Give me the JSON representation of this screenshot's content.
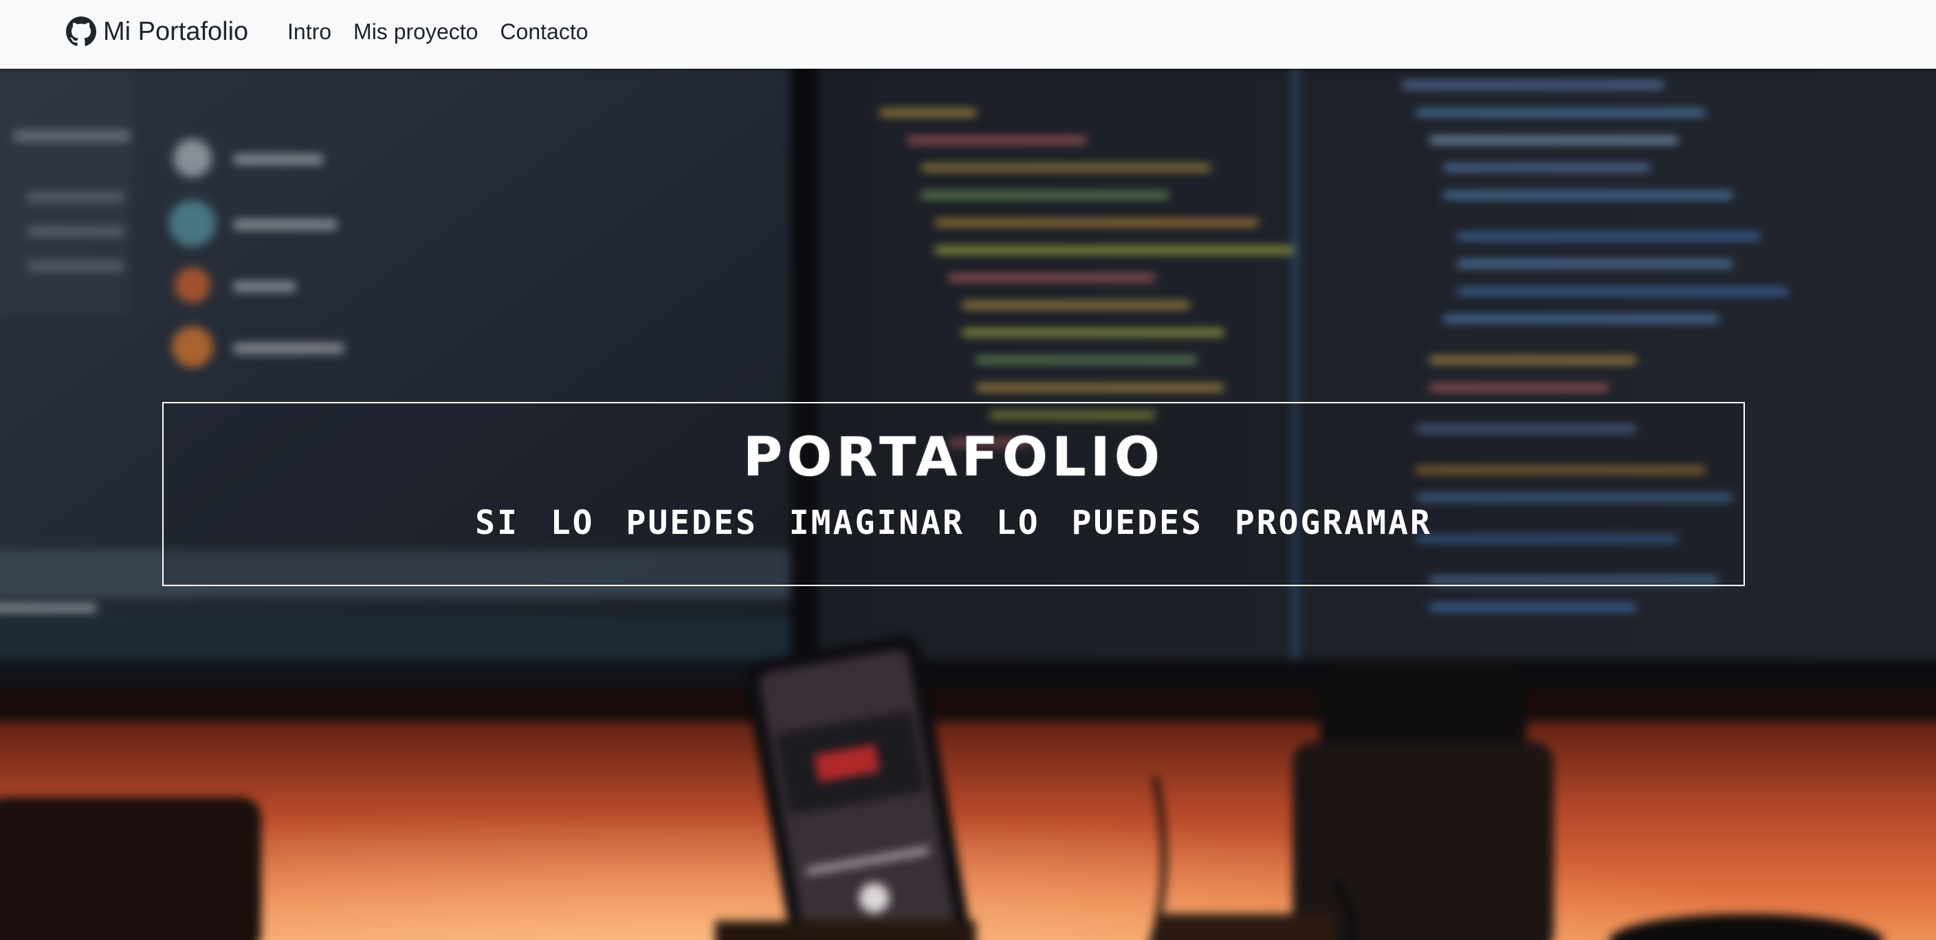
{
  "navbar": {
    "brand_label": "Mi Portafolio",
    "brand_icon": "github-icon",
    "links": [
      {
        "label": "Intro"
      },
      {
        "label": "Mis proyecto"
      },
      {
        "label": "Contacto"
      }
    ]
  },
  "hero": {
    "title": "PORTAFOLIO",
    "subtitle": "SI LO PUEDES IMAGINAR LO PUEDES PROGRAMAR"
  },
  "colors": {
    "navbar_bg": "#f8f9fa",
    "navbar_text": "#212529",
    "banner_border": "#ffffff",
    "banner_text": "#ffffff"
  }
}
